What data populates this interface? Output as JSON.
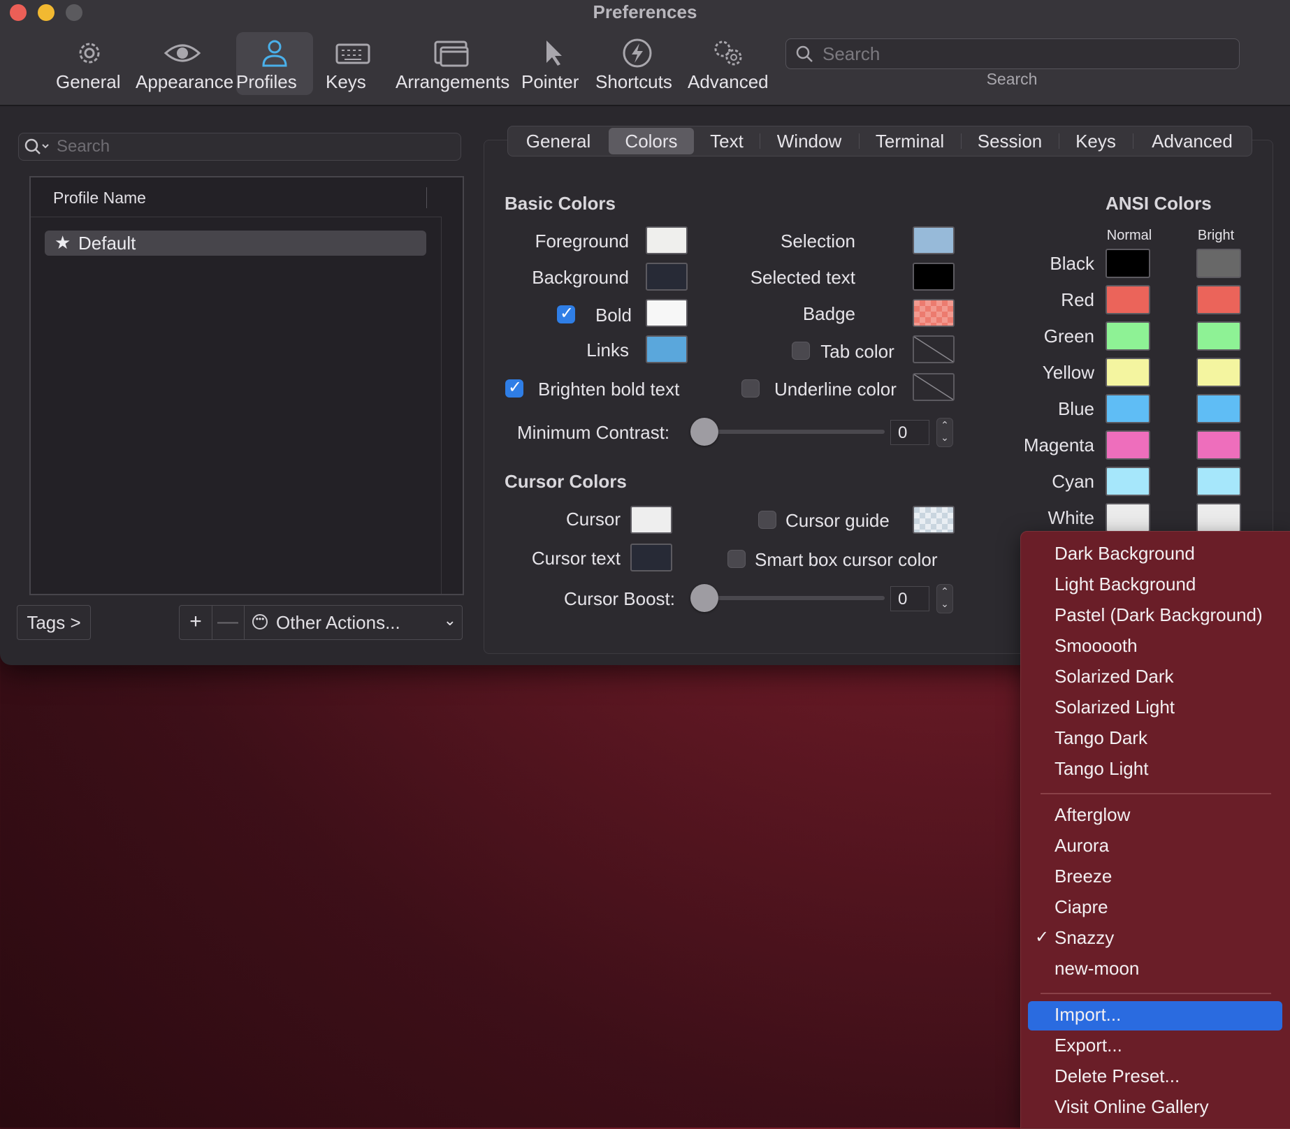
{
  "window": {
    "title": "Preferences"
  },
  "toolbar": {
    "items": [
      {
        "label": "General",
        "icon": "gear-icon"
      },
      {
        "label": "Appearance",
        "icon": "eye-icon"
      },
      {
        "label": "Profiles",
        "icon": "person-icon",
        "active": true
      },
      {
        "label": "Keys",
        "icon": "keyboard-icon"
      },
      {
        "label": "Arrangements",
        "icon": "windows-icon"
      },
      {
        "label": "Pointer",
        "icon": "pointer-icon"
      },
      {
        "label": "Shortcuts",
        "icon": "bolt-icon"
      },
      {
        "label": "Advanced",
        "icon": "gears-icon"
      }
    ],
    "search": {
      "placeholder": "Search",
      "label": "Search"
    }
  },
  "sidebar": {
    "search_placeholder": "Search",
    "column_header": "Profile Name",
    "profiles": [
      {
        "name": "Default",
        "icon": "star-icon"
      }
    ],
    "tags_button": "Tags >",
    "add_button": "+",
    "remove_button": "—",
    "other_actions": "Other Actions..."
  },
  "tabs": [
    "General",
    "Colors",
    "Text",
    "Window",
    "Terminal",
    "Session",
    "Keys",
    "Advanced"
  ],
  "active_tab": "Colors",
  "basic_colors": {
    "title": "Basic Colors",
    "foreground": {
      "label": "Foreground",
      "color": "#efefed"
    },
    "background": {
      "label": "Background",
      "color": "#272a36"
    },
    "bold": {
      "label": "Bold",
      "color": "#f7f7f7",
      "checked": true
    },
    "links": {
      "label": "Links",
      "color": "#5aa7dc"
    },
    "selection": {
      "label": "Selection",
      "color": "#97bad9"
    },
    "selected_text": {
      "label": "Selected text",
      "color": "#000000"
    },
    "badge": {
      "label": "Badge",
      "color": "#ec7b6f"
    },
    "tab_color": {
      "label": "Tab color",
      "checked": false
    },
    "brighten_bold": {
      "label": "Brighten bold text",
      "checked": true
    },
    "underline_color": {
      "label": "Underline color",
      "checked": false
    },
    "min_contrast": {
      "label": "Minimum Contrast:",
      "value": "0"
    }
  },
  "cursor_colors": {
    "title": "Cursor Colors",
    "cursor": {
      "label": "Cursor",
      "color": "#eeeeee"
    },
    "cursor_text": {
      "label": "Cursor text",
      "color": "#272a36"
    },
    "cursor_guide": {
      "label": "Cursor guide",
      "checked": false
    },
    "smart_box": {
      "label": "Smart box cursor color",
      "checked": false
    },
    "boost": {
      "label": "Cursor Boost:",
      "value": "0"
    }
  },
  "ansi": {
    "title": "ANSI Colors",
    "normal_label": "Normal",
    "bright_label": "Bright",
    "rows": [
      {
        "name": "Black",
        "normal": "#000000",
        "bright": "#686868"
      },
      {
        "name": "Red",
        "normal": "#eb645a",
        "bright": "#eb645a"
      },
      {
        "name": "Green",
        "normal": "#8ef295",
        "bright": "#8ef295"
      },
      {
        "name": "Yellow",
        "normal": "#f4f5a0",
        "bright": "#f4f5a0"
      },
      {
        "name": "Blue",
        "normal": "#5fbdf5",
        "bright": "#5fbdf5"
      },
      {
        "name": "Magenta",
        "normal": "#ee6ebc",
        "bright": "#ee6ebc"
      },
      {
        "name": "Cyan",
        "normal": "#a6e7fb",
        "bright": "#a6e7fb"
      },
      {
        "name": "White",
        "normal": "#ececec",
        "bright": "#ececec"
      }
    ]
  },
  "presets_menu": {
    "group1": [
      "Dark Background",
      "Light Background",
      "Pastel (Dark Background)",
      "Smooooth",
      "Solarized Dark",
      "Solarized Light",
      "Tango Dark",
      "Tango Light"
    ],
    "group2": [
      "Afterglow",
      "Aurora",
      "Breeze",
      "Ciapre",
      "Snazzy",
      "new-moon"
    ],
    "checked": "Snazzy",
    "group3": [
      "Import...",
      "Export...",
      "Delete Preset...",
      "Visit Online Gallery"
    ],
    "highlighted": "Import..."
  }
}
